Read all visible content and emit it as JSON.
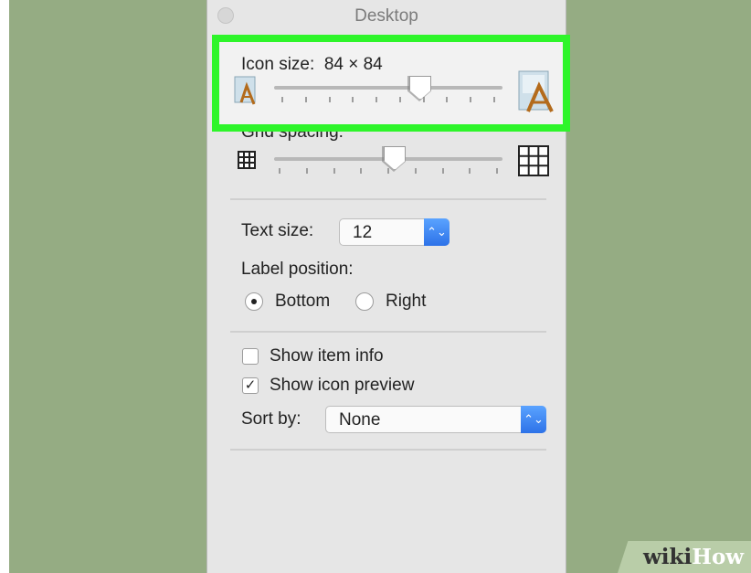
{
  "window": {
    "title": "Desktop"
  },
  "icon_size": {
    "label": "Icon size:",
    "value": "84 × 84",
    "slider_level": 0.63
  },
  "grid_spacing": {
    "label": "Grid spacing:",
    "slider_level": 0.53
  },
  "text_size": {
    "label": "Text size:",
    "value": "12"
  },
  "label_position": {
    "label": "Label position:",
    "options": [
      {
        "label": "Bottom",
        "selected": true
      },
      {
        "label": "Right",
        "selected": false
      }
    ]
  },
  "checkboxes": [
    {
      "label": "Show item info",
      "checked": false
    },
    {
      "label": "Show icon preview",
      "checked": true
    }
  ],
  "sort_by": {
    "label": "Sort by:",
    "value": "None"
  },
  "watermark": {
    "wiki": "wiki",
    "how": "How"
  },
  "colors": {
    "highlight": "#2ef52a",
    "background": "#95ac83",
    "accent": "#2d72e8"
  }
}
